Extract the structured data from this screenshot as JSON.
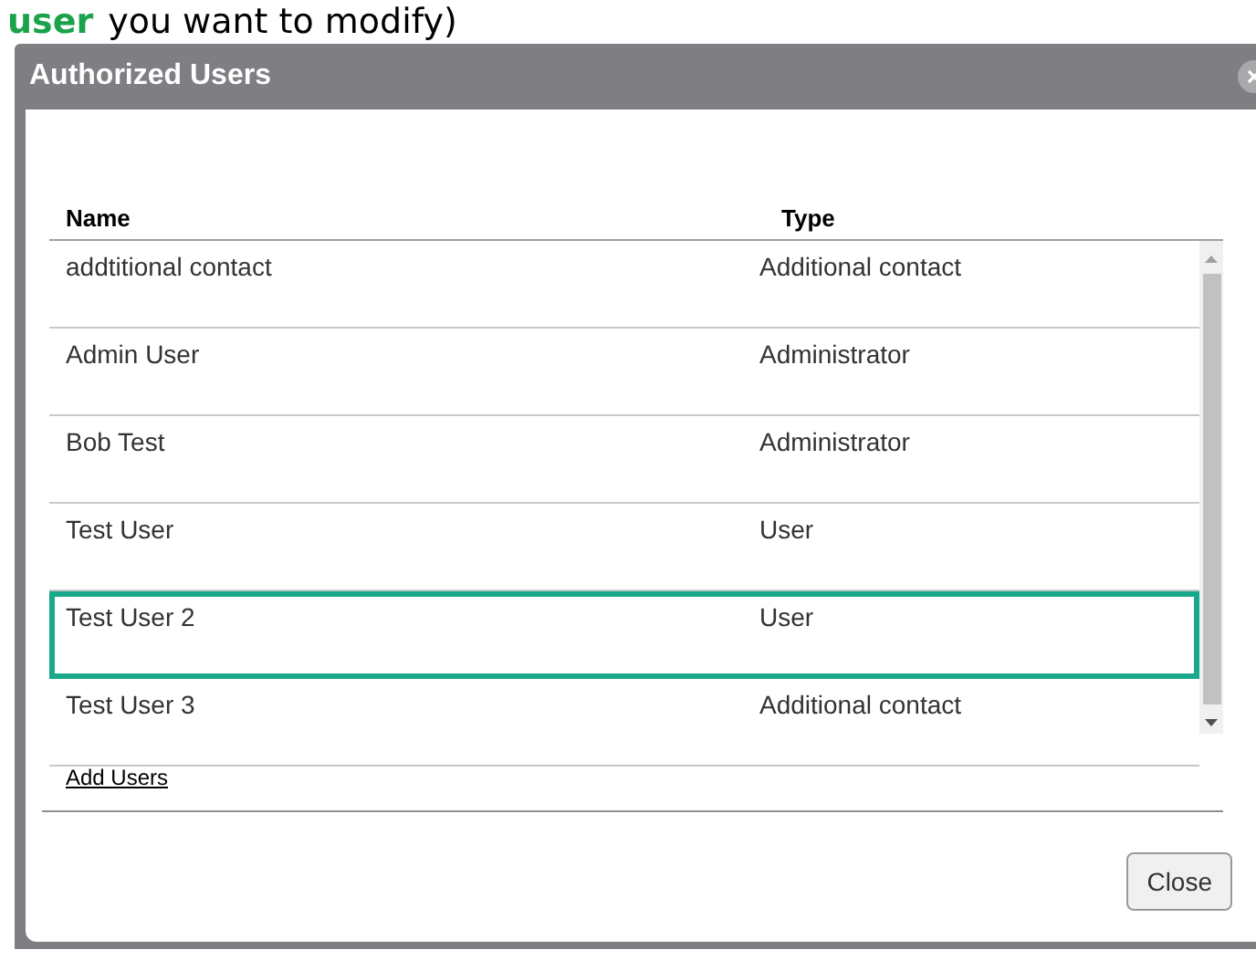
{
  "instruction": {
    "highlight": "user",
    "rest": "you want to modify)"
  },
  "dialog": {
    "title": "Authorized Users",
    "table": {
      "columns": [
        "Name",
        "Type"
      ],
      "rows": [
        {
          "name": "addtitional contact",
          "type": "Additional contact",
          "selected": false
        },
        {
          "name": "Admin User",
          "type": "Administrator",
          "selected": false
        },
        {
          "name": "Bob Test",
          "type": "Administrator",
          "selected": false
        },
        {
          "name": "Test User",
          "type": "User",
          "selected": false
        },
        {
          "name": "Test User 2",
          "type": "User",
          "selected": true
        },
        {
          "name": "Test User 3",
          "type": "Additional contact",
          "selected": false
        }
      ]
    },
    "add_link": "Add Users",
    "buttons": [
      "Close"
    ]
  }
}
